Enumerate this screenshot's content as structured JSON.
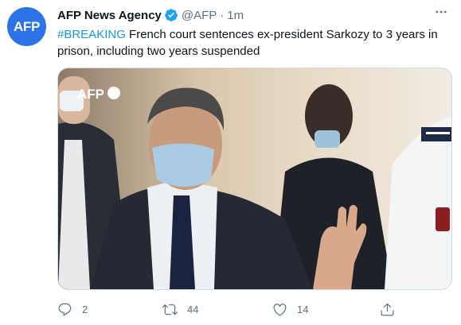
{
  "author": {
    "display_name": "AFP News Agency",
    "handle": "@AFP",
    "separator": "·",
    "time": "1m",
    "avatar_text": "AFP",
    "avatar_color": "#2b73e6",
    "verified": true
  },
  "tweet": {
    "hashtag": "#BREAKING",
    "text": " French court sentences ex-president Sarkozy to 3 years in prison, including two years suspended"
  },
  "media": {
    "watermark": "AFP"
  },
  "actions": {
    "reply_icon": "reply-icon",
    "reply_count": "2",
    "retweet_icon": "retweet-icon",
    "retweet_count": "44",
    "like_icon": "heart-icon",
    "like_count": "14",
    "share_icon": "share-icon"
  },
  "colors": {
    "hashtag": "#1b95e0",
    "muted": "#5b7083",
    "verified": "#1da1f2"
  }
}
